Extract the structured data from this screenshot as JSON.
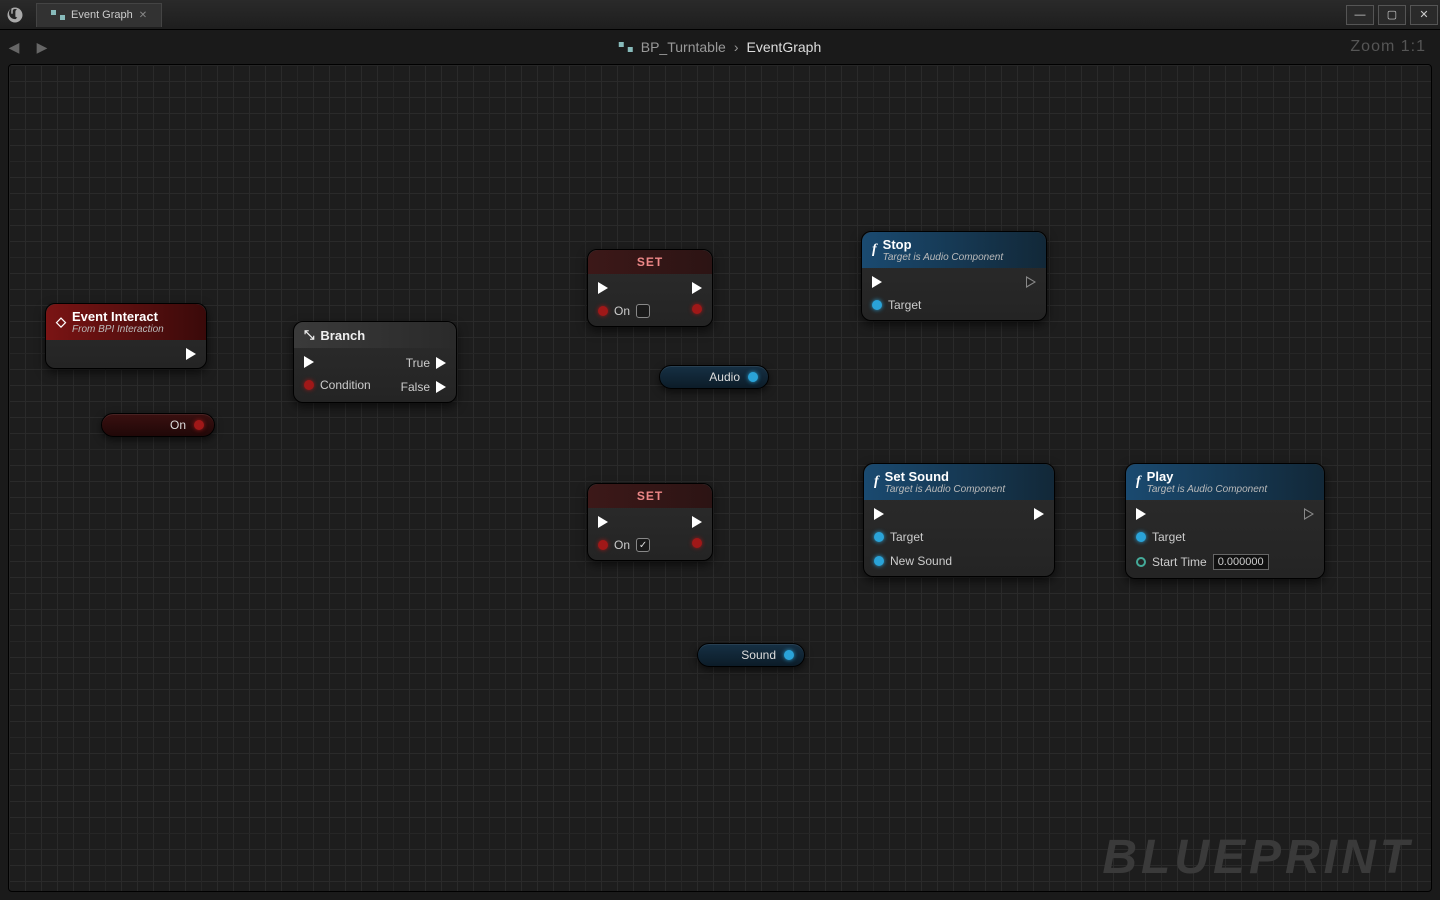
{
  "titlebar": {
    "tab_label": "Event Graph"
  },
  "crumbs": {
    "blueprint": "BP_Turntable",
    "graph": "EventGraph",
    "zoom": "Zoom 1:1"
  },
  "watermark": "BLUEPRINT",
  "nodes": {
    "event": {
      "title": "Event Interact",
      "subtitle": "From BPI Interaction"
    },
    "branch": {
      "title": "Branch",
      "cond": "Condition",
      "true": "True",
      "false": "False"
    },
    "set1": {
      "title": "SET",
      "var": "On"
    },
    "set2": {
      "title": "SET",
      "var": "On"
    },
    "stop": {
      "title": "Stop",
      "subtitle": "Target is Audio Component",
      "target": "Target"
    },
    "setsound": {
      "title": "Set Sound",
      "subtitle": "Target is Audio Component",
      "target": "Target",
      "newsound": "New Sound"
    },
    "play": {
      "title": "Play",
      "subtitle": "Target is Audio Component",
      "target": "Target",
      "starttime": "Start Time",
      "startval": "0.000000"
    }
  },
  "pills": {
    "on": "On",
    "audio": "Audio",
    "sound": "Sound"
  }
}
